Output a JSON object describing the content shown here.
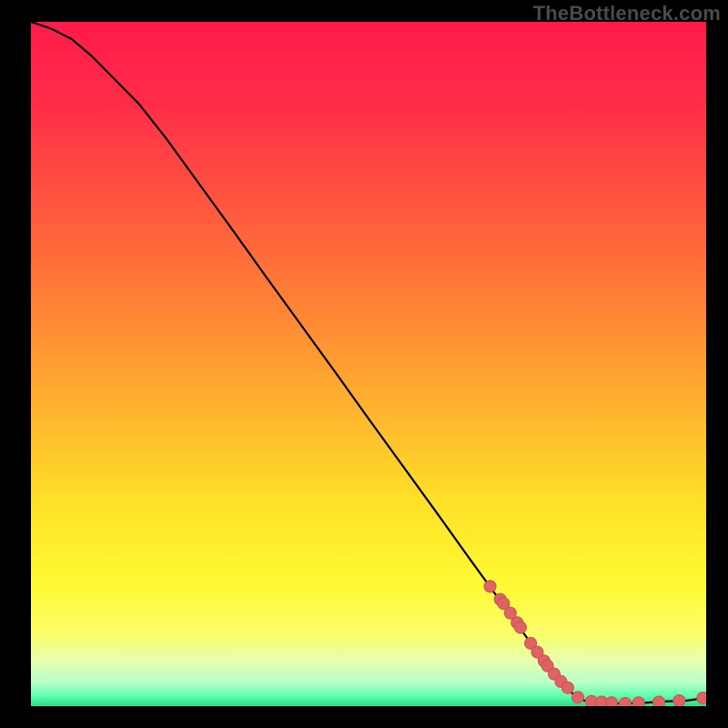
{
  "watermark": "TheBottleneck.com",
  "chart_data": {
    "type": "line",
    "title": "",
    "xlabel": "",
    "ylabel": "",
    "xlim": [
      0,
      100
    ],
    "ylim": [
      0,
      100
    ],
    "grid": false,
    "series": [
      {
        "name": "curve",
        "x": [
          0,
          3,
          6,
          9,
          12,
          16,
          20,
          25,
          30,
          35,
          40,
          45,
          50,
          55,
          60,
          65,
          70,
          75,
          80,
          82,
          85,
          88,
          91,
          94,
          97,
          100
        ],
        "y": [
          100,
          99,
          97.5,
          95,
          92,
          88,
          83,
          76.2,
          69.4,
          62.5,
          55.7,
          48.9,
          42,
          35.2,
          28.4,
          21.5,
          14.7,
          7.9,
          2.0,
          0.8,
          0.4,
          0.4,
          0.5,
          0.7,
          0.8,
          1.2
        ]
      }
    ],
    "marker_cluster": {
      "name": "points",
      "x": [
        68,
        69.5,
        70,
        71,
        72,
        72.5,
        74,
        75,
        76,
        76.5,
        77.5,
        78.5,
        79.5,
        81,
        83,
        84.5,
        86,
        88,
        90,
        93,
        96,
        99.5
      ],
      "y": [
        17.5,
        15.6,
        15.0,
        13.6,
        12.2,
        11.5,
        9.2,
        7.9,
        6.6,
        5.9,
        4.7,
        3.6,
        2.7,
        1.3,
        0.7,
        0.6,
        0.5,
        0.4,
        0.5,
        0.6,
        0.8,
        1.2
      ]
    },
    "background_gradient": {
      "stops": [
        {
          "offset": 0.0,
          "color": "#ff1a4b"
        },
        {
          "offset": 0.12,
          "color": "#ff2d48"
        },
        {
          "offset": 0.28,
          "color": "#ff5a3e"
        },
        {
          "offset": 0.44,
          "color": "#ff8a34"
        },
        {
          "offset": 0.58,
          "color": "#ffb82e"
        },
        {
          "offset": 0.7,
          "color": "#ffe028"
        },
        {
          "offset": 0.82,
          "color": "#fff932"
        },
        {
          "offset": 0.895,
          "color": "#fbff6a"
        },
        {
          "offset": 0.935,
          "color": "#e4ffb0"
        },
        {
          "offset": 0.965,
          "color": "#b9ffca"
        },
        {
          "offset": 0.985,
          "color": "#5effab"
        },
        {
          "offset": 1.0,
          "color": "#2bdc8a"
        }
      ]
    },
    "colors": {
      "curve": "#000000",
      "marker_fill": "#e06363",
      "marker_stroke": "#c94f55"
    }
  }
}
